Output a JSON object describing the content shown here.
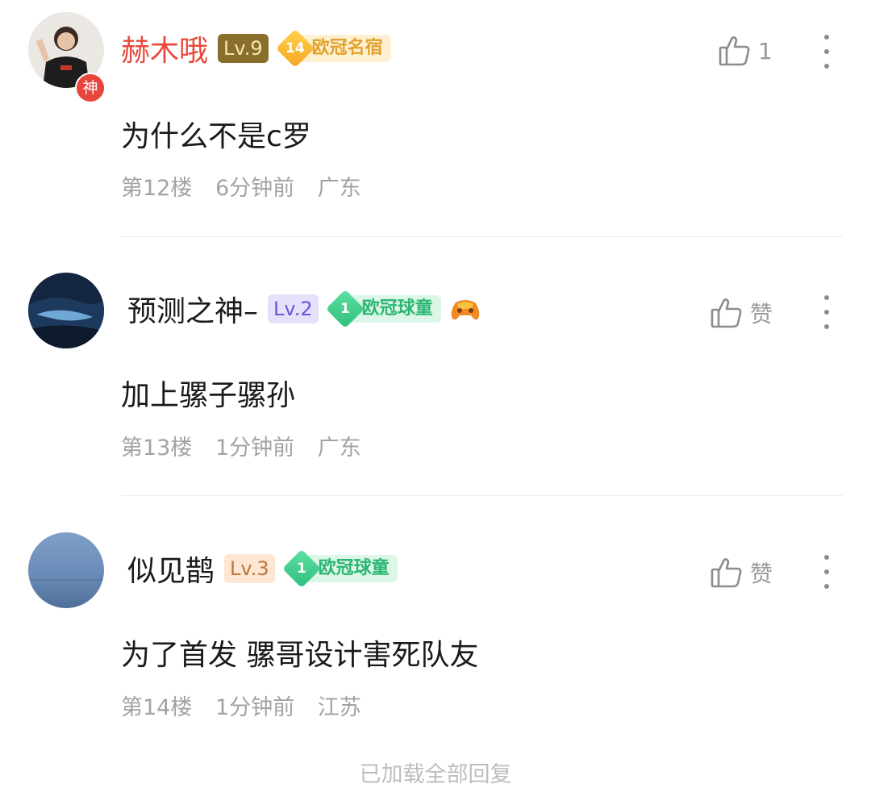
{
  "comments": [
    {
      "username": "赫木哦",
      "avatar_badge": "神",
      "level": "Lv.9",
      "fan_level": "14",
      "fan_title": "欧冠名宿",
      "like_count": "1",
      "content": "为什么不是c罗",
      "floor": "第12楼",
      "time": "6分钟前",
      "location": "广东"
    },
    {
      "username": "预测之神–",
      "level": "Lv.2",
      "fan_level": "1",
      "fan_title": "欧冠球童",
      "emoji": "game-controller-icon",
      "like_label": "赞",
      "content": "加上骡子骡孙",
      "floor": "第13楼",
      "time": "1分钟前",
      "location": "广东"
    },
    {
      "username": "似见鹊",
      "level": "Lv.3",
      "fan_level": "1",
      "fan_title": "欧冠球童",
      "like_label": "赞",
      "content": "为了首发 骡哥设计害死队友",
      "floor": "第14楼",
      "time": "1分钟前",
      "location": "江苏"
    }
  ],
  "footer": {
    "all_loaded": "已加载全部回复"
  },
  "colors": {
    "vip_name": "#e84a3e",
    "meta_text": "#a3a3a3",
    "fan_gold": "#e3a12b",
    "fan_green": "#2bb672"
  }
}
